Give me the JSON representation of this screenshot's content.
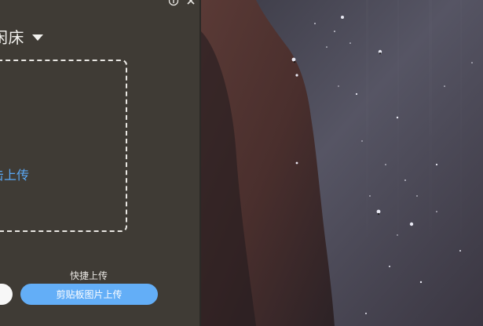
{
  "panel": {
    "title": "闲床",
    "drop_zone_text": "击上传",
    "quick_upload_label": "快捷上传",
    "clipboard_button_label": "剪贴板图片上传"
  },
  "icons": {
    "info": "info-icon",
    "close": "close-icon",
    "caret": "caret-down-icon"
  },
  "colors": {
    "panel_bg": "#3f3b35",
    "accent": "#63aef7",
    "link_blue": "#5aa8f5"
  },
  "scene": {
    "description_color_top": "#4a4a57",
    "description_color_bottom": "#2d2a31"
  }
}
